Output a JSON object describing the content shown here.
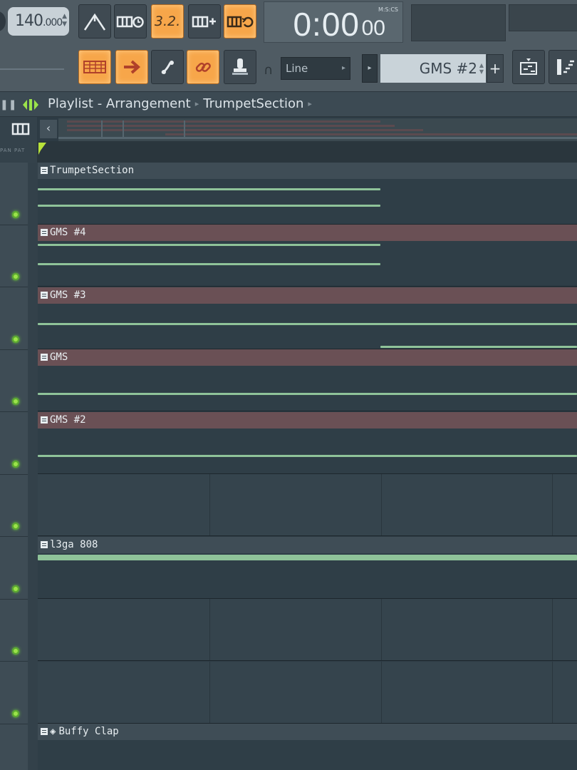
{
  "toolbar": {
    "tempo_int": "140",
    "tempo_dec": ".000",
    "time_main": "0:00",
    "time_frac": "00",
    "time_label": "M:S:CS",
    "button_3_label": "3.2.",
    "snap_value": "Line",
    "pattern_name": "GMS #2",
    "pattern_add": "+"
  },
  "titlebar": {
    "title": "Playlist - Arrangement",
    "section": "TrumpetSection"
  },
  "header": {
    "labels": "PAN  PAT"
  },
  "clips": {
    "trumpet": "TrumpetSection",
    "gms4": "GMS #4",
    "gms3": "GMS #3",
    "gms": "GMS",
    "gms2": "GMS #2",
    "l3ga": "l3ga 808",
    "buffy": "Buffy Clap"
  },
  "colors": {
    "accent": "#f7a64a",
    "note": "#8fc399",
    "led": "#9be34a",
    "clip_red": "#6a5055",
    "clip_blue": "#3f4d56"
  }
}
